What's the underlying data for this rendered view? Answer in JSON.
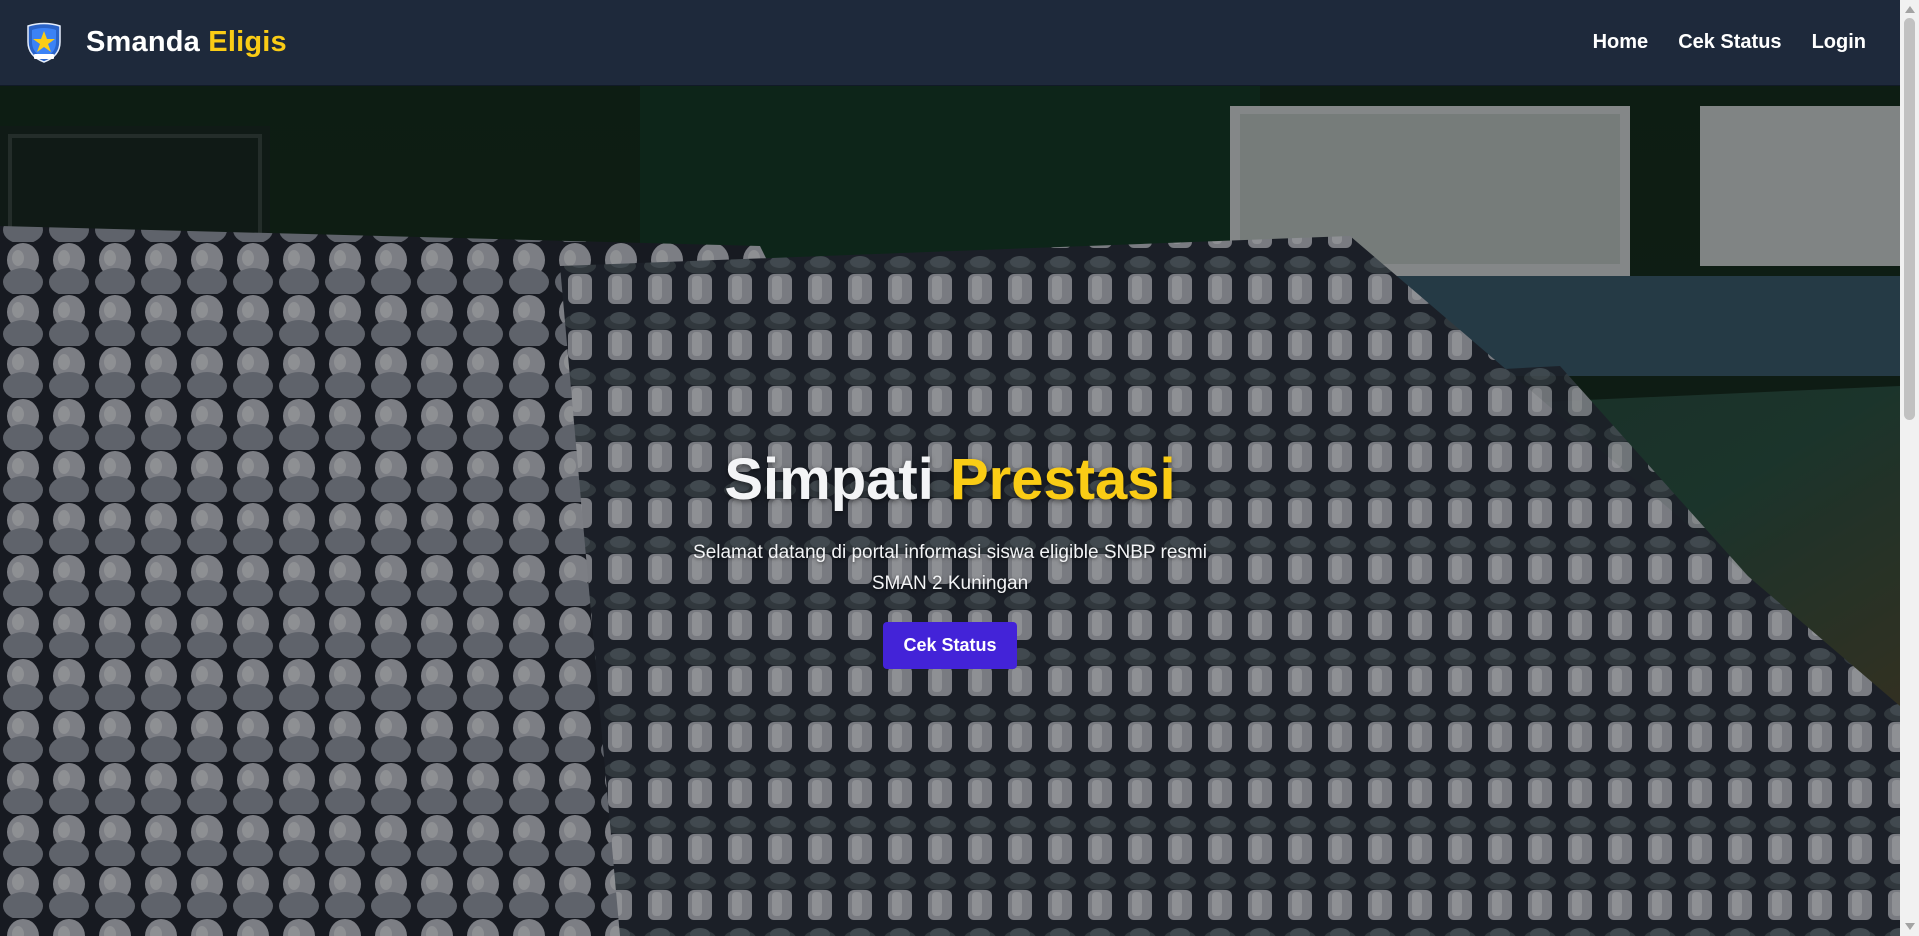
{
  "navbar": {
    "brand_primary": "Smanda",
    "brand_accent": "Eligis",
    "links": [
      {
        "label": "Home"
      },
      {
        "label": "Cek Status"
      },
      {
        "label": "Login"
      }
    ]
  },
  "hero": {
    "title_primary": "Simpati",
    "title_accent": "Prestasi",
    "subtitle": "Selamat datang di portal informasi siswa eligible SNBP resmi SMAN 2 Kuningan",
    "button_label": "Cek Status"
  },
  "colors": {
    "navbar_bg": "#1e293b",
    "accent_yellow": "#facc15",
    "button_bg": "#4323d8"
  }
}
